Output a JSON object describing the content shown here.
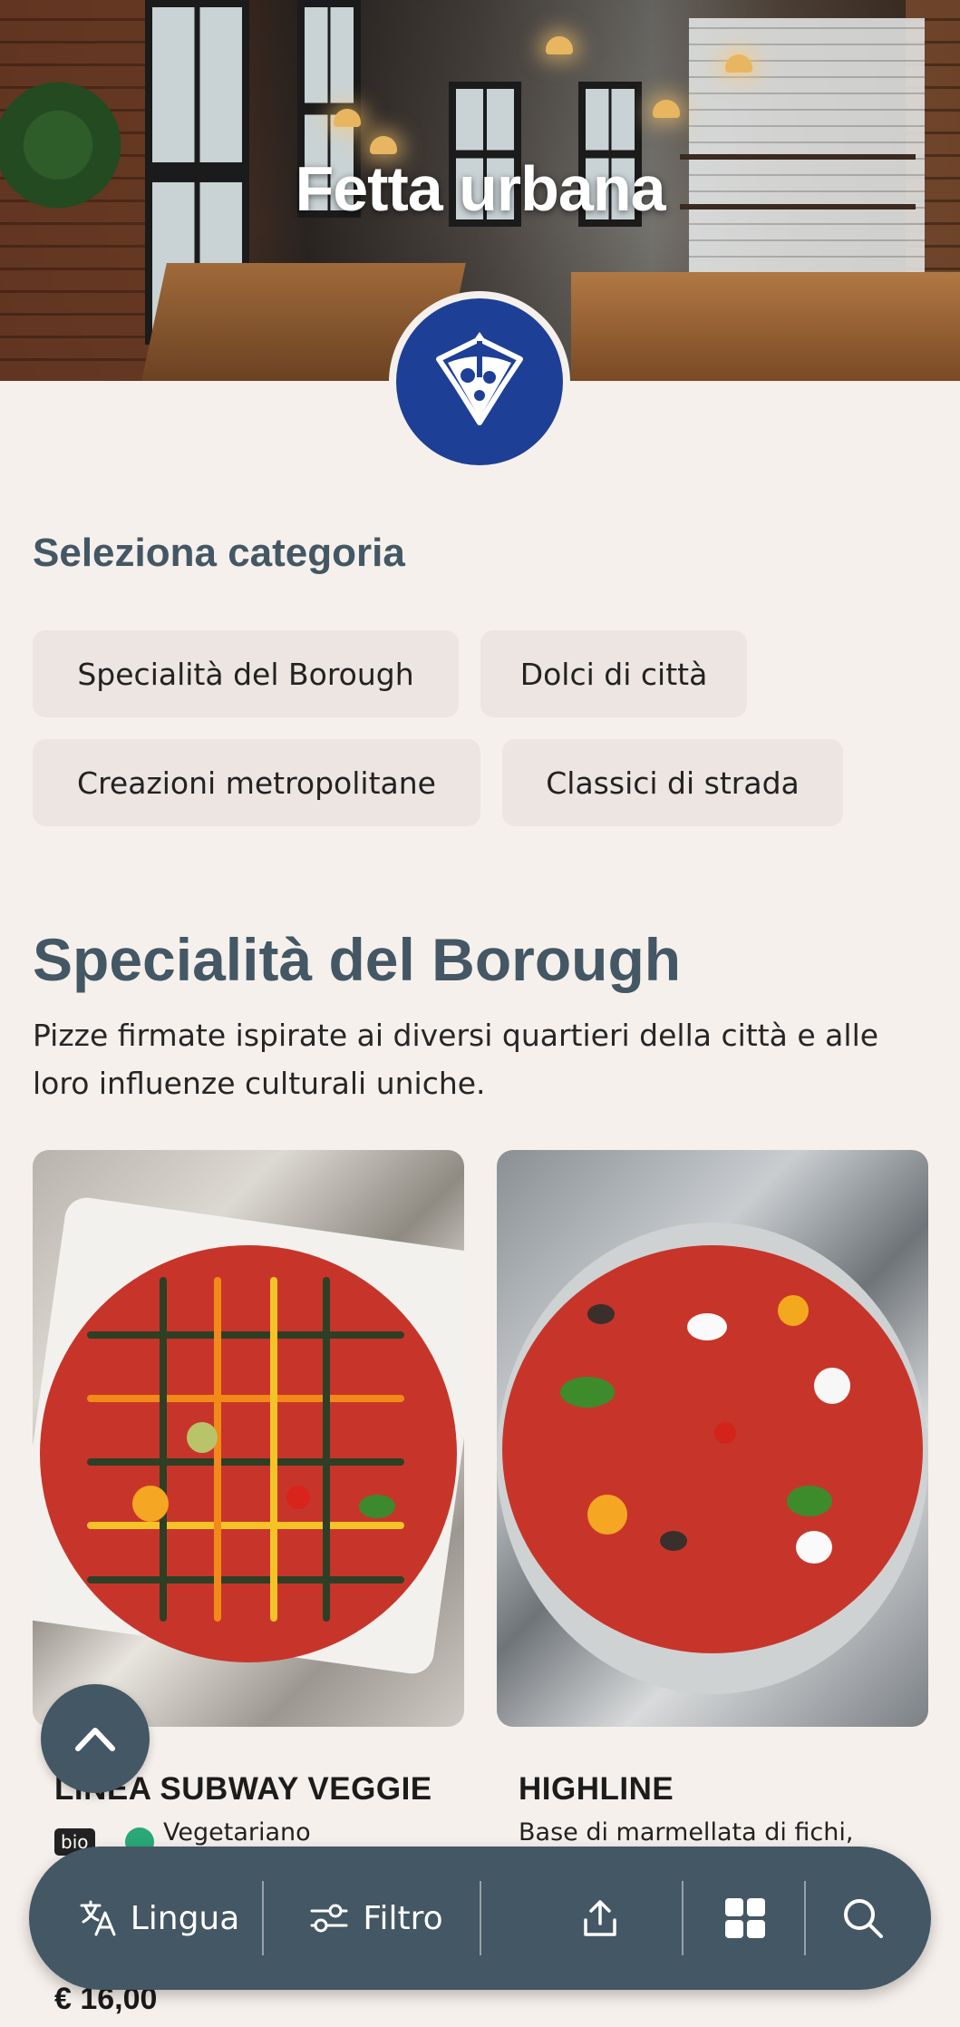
{
  "header": {
    "restaurant_name": "Fetta urbana"
  },
  "categories_section": {
    "label": "Seleziona categoria",
    "chips": [
      "Specialità del Borough",
      "Dolci di città",
      "Creazioni metropolitane",
      "Classici di strada"
    ]
  },
  "category": {
    "title": "Specialità del Borough",
    "description": "Pizze firmate ispirate ai diversi quartieri della città e alle loro influenze culturali uniche."
  },
  "products": [
    {
      "name": "LINEA SUBWAY VEGGIE",
      "badge": "bio",
      "diet_label": "Vegetariano",
      "price": "€ 16,00"
    },
    {
      "name": "HIGHLINE",
      "description": "Base di marmellata di fichi,"
    }
  ],
  "bottom_bar": {
    "language_label": "Lingua",
    "filter_label": "Filtro"
  },
  "colors": {
    "accent": "#435764",
    "logo_blue": "#1d3f95",
    "background": "#f6f0ec",
    "chip_bg": "#ece5e1"
  },
  "icons": [
    "chevron-up-icon",
    "translate-icon",
    "filter-icon",
    "share-icon",
    "grid-icon",
    "search-icon",
    "pizza-logo-icon"
  ]
}
